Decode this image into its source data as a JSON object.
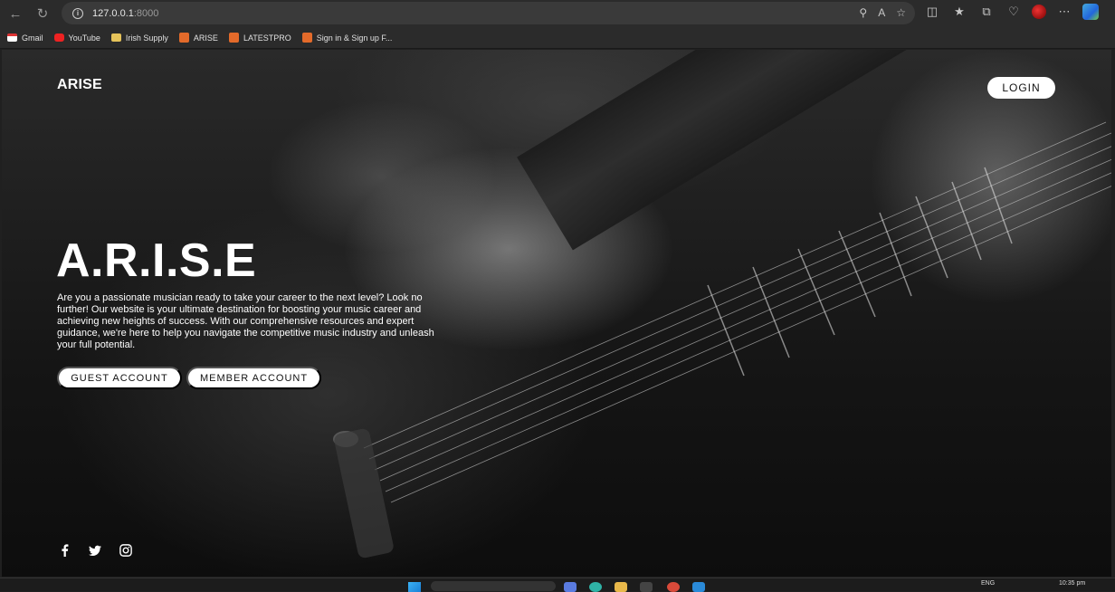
{
  "browser": {
    "url_host": "127.0.0.1",
    "url_port": ":8000",
    "bookmarks": [
      "Gmail",
      "YouTube",
      "Irish Supply",
      "ARISE",
      "LATESTPRO",
      "Sign in & Sign up F..."
    ]
  },
  "header": {
    "logo": "ARISE",
    "login_label": "LOGIN"
  },
  "hero": {
    "title": "A.R.I.S.E",
    "description": "Are you a passionate musician ready to take your career to the next level? Look no further! Our website is your ultimate destination for boosting your music career and achieving new heights of success. With our comprehensive resources and expert guidance, we're here to help you navigate the competitive music industry and unleash your full potential.",
    "guest_label": "GUEST ACCOUNT",
    "member_label": "MEMBER ACCOUNT"
  },
  "socials": [
    "facebook-icon",
    "twitter-icon",
    "instagram-icon"
  ],
  "taskbar": {
    "lang": "ENG",
    "time": "10:35 pm"
  }
}
